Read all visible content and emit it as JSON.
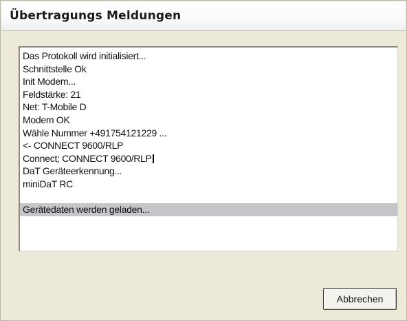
{
  "window": {
    "title": "Übertragungs Meldungen"
  },
  "log": {
    "lines": [
      "Das Protokoll wird initialisiert...",
      "Schnittstelle Ok",
      "Init Modem...",
      "Feldstärke: 21",
      "Net: T-Mobile D",
      "Modem OK",
      "Wähle Nummer +491754121229 ...",
      "<- CONNECT 9600/RLP",
      "Connect; CONNECT 9600/RLP",
      "DaT Geräteerkennung...",
      "miniDaT RC",
      "",
      "Gerätedaten werden geladen..."
    ],
    "selected_line": "Gerätedaten werden geladen..."
  },
  "buttons": {
    "cancel_label": "Abbrechen"
  },
  "colors": {
    "window_bg": "#ece9d8",
    "selection_bg": "#c6c5c9"
  }
}
